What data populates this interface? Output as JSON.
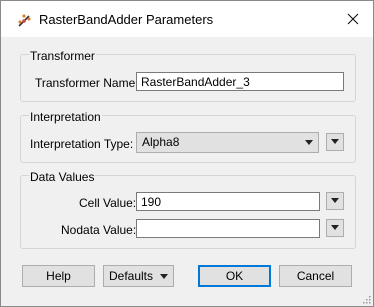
{
  "window": {
    "title": "RasterBandAdder Parameters",
    "app_icon": "fme-transformer-icon",
    "close_icon": "close-icon"
  },
  "transformer": {
    "group_title": "Transformer",
    "name_label": "Transformer Name:",
    "name_value": "RasterBandAdder_3"
  },
  "interpretation": {
    "group_title": "Interpretation",
    "type_label": "Interpretation Type:",
    "type_value": "Alpha8"
  },
  "data_values": {
    "group_title": "Data Values",
    "cell_label": "Cell Value:",
    "cell_value": "190",
    "nodata_label": "Nodata Value:",
    "nodata_value": ""
  },
  "buttons": {
    "help": "Help",
    "defaults": "Defaults",
    "ok": "OK",
    "cancel": "Cancel"
  }
}
